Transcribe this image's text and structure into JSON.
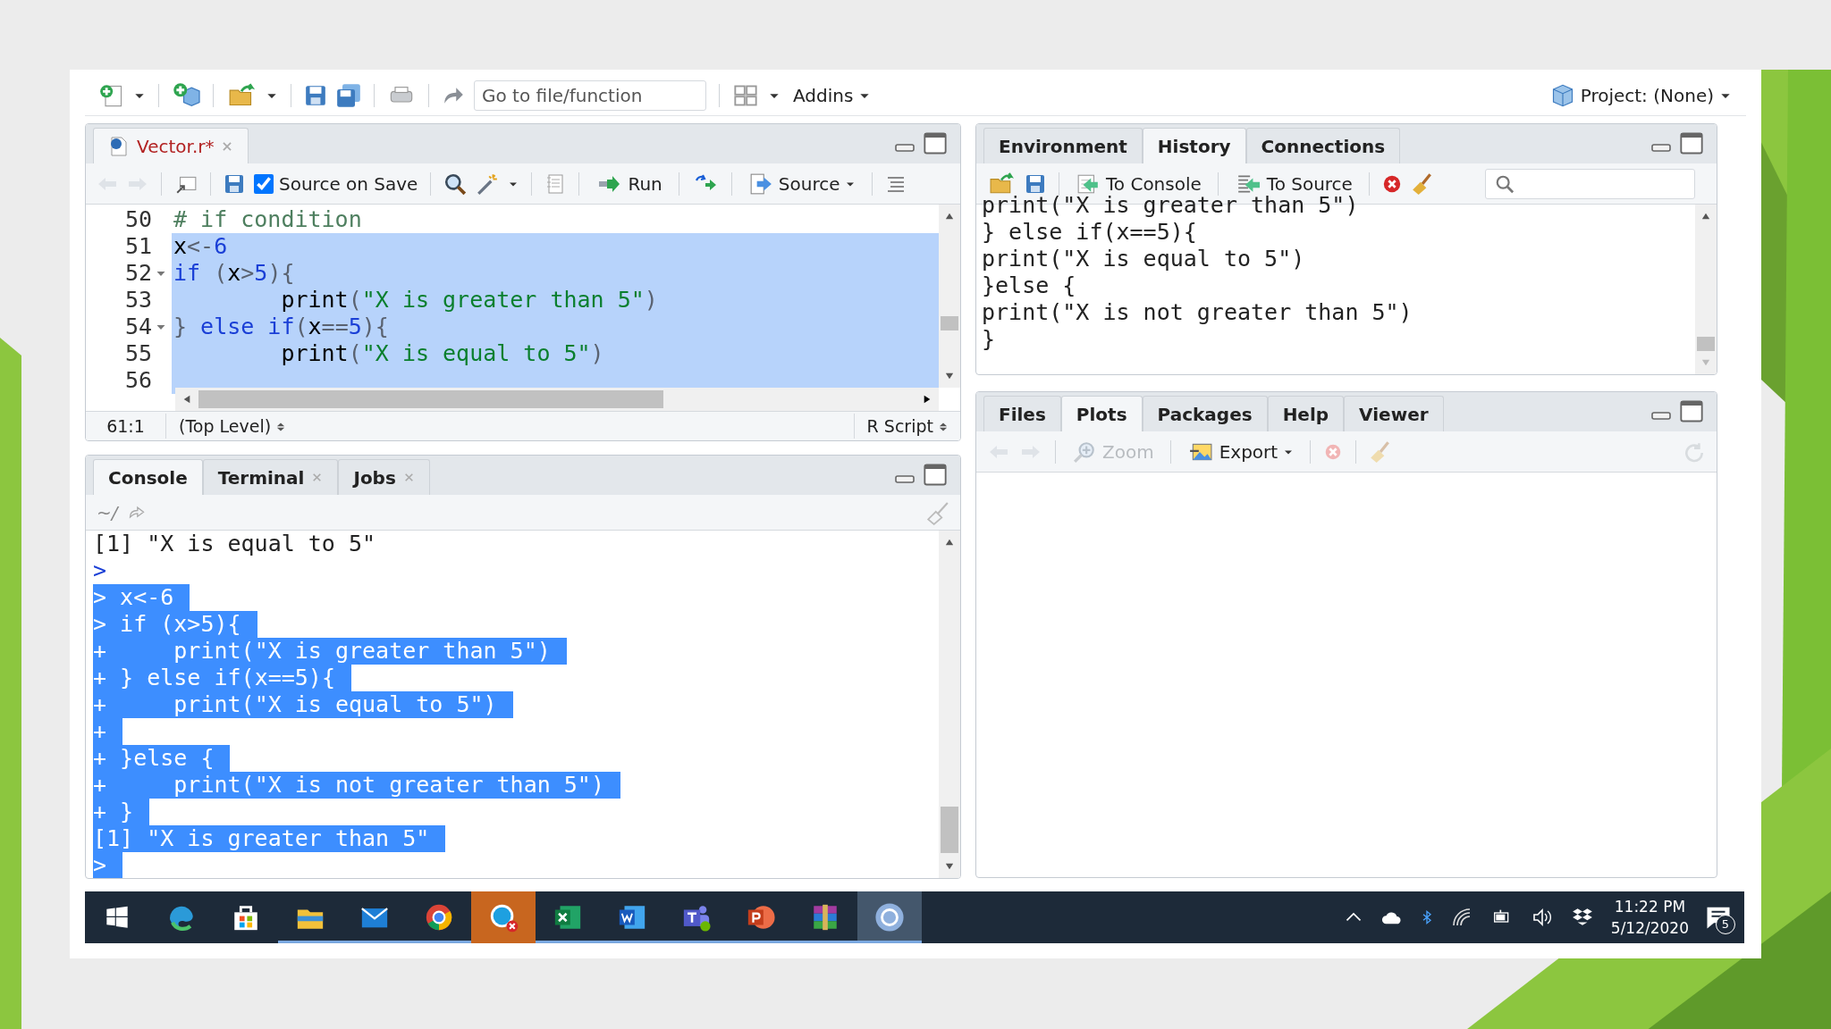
{
  "toolbar": {
    "goto_placeholder": "Go to file/function",
    "addins": "Addins",
    "project": "Project: (None)"
  },
  "editor": {
    "tab": {
      "title": "Vector.r*",
      "unsaved": true
    },
    "source_on_save": {
      "label": "Source on Save",
      "checked": true
    },
    "run": "Run",
    "source": "Source",
    "lines": [
      {
        "number": "50",
        "selected": false,
        "fold": false,
        "segments": [
          {
            "kind": "comment",
            "text": "# if condition"
          }
        ]
      },
      {
        "number": "51",
        "selected": true,
        "fold": false,
        "segments": [
          {
            "kind": "plain",
            "text": "x"
          },
          {
            "kind": "punct",
            "text": "<-"
          },
          {
            "kind": "number",
            "text": "6"
          }
        ]
      },
      {
        "number": "52",
        "selected": true,
        "fold": true,
        "segments": [
          {
            "kind": "keyword",
            "text": "if"
          },
          {
            "kind": "punct",
            "text": " ("
          },
          {
            "kind": "plain",
            "text": "x"
          },
          {
            "kind": "punct",
            "text": ">"
          },
          {
            "kind": "number",
            "text": "5"
          },
          {
            "kind": "punct",
            "text": "){"
          }
        ]
      },
      {
        "number": "53",
        "selected": true,
        "fold": false,
        "segments": [
          {
            "kind": "plain",
            "text": "        print"
          },
          {
            "kind": "punct",
            "text": "("
          },
          {
            "kind": "string",
            "text": "\"X is greater than 5\""
          },
          {
            "kind": "punct",
            "text": ")"
          }
        ]
      },
      {
        "number": "54",
        "selected": true,
        "fold": true,
        "segments": [
          {
            "kind": "punct",
            "text": "}"
          },
          {
            "kind": "keyword",
            "text": " else if"
          },
          {
            "kind": "punct",
            "text": "("
          },
          {
            "kind": "plain",
            "text": "x"
          },
          {
            "kind": "punct",
            "text": "=="
          },
          {
            "kind": "number",
            "text": "5"
          },
          {
            "kind": "punct",
            "text": "){"
          }
        ]
      },
      {
        "number": "55",
        "selected": true,
        "fold": false,
        "segments": [
          {
            "kind": "plain",
            "text": "        print"
          },
          {
            "kind": "punct",
            "text": "("
          },
          {
            "kind": "string",
            "text": "\"X is equal to 5\""
          },
          {
            "kind": "punct",
            "text": ")"
          }
        ]
      },
      {
        "number": "56",
        "selected": true,
        "fold": false
      }
    ],
    "status": {
      "position": "61:1",
      "scope": "(Top Level)",
      "file_type": "R Script"
    }
  },
  "console": {
    "tabs": [
      {
        "label": "Console",
        "selected": true,
        "closable": false
      },
      {
        "label": "Terminal",
        "selected": false,
        "closable": true
      },
      {
        "label": "Jobs",
        "selected": false,
        "closable": true
      }
    ],
    "path": "~/",
    "lines": [
      {
        "kind": "output",
        "text": "[1] \"X is equal to 5\"",
        "selected": false
      },
      {
        "kind": "input",
        "prompt": ">",
        "selected": false
      },
      {
        "kind": "input",
        "prompt": ">",
        "text": "x<-6",
        "selected": true
      },
      {
        "kind": "input",
        "prompt": ">",
        "text": "if (x>5){",
        "selected": true
      },
      {
        "kind": "input",
        "prompt": "+",
        "text": "    print(\"X is greater than 5\")",
        "selected": true
      },
      {
        "kind": "input",
        "prompt": "+",
        "text": "} else if(x==5){",
        "selected": true
      },
      {
        "kind": "input",
        "prompt": "+",
        "text": "    print(\"X is equal to 5\")",
        "selected": true
      },
      {
        "kind": "input",
        "prompt": "+",
        "selected": true
      },
      {
        "kind": "input",
        "prompt": "+",
        "text": "}else {",
        "selected": true
      },
      {
        "kind": "input",
        "prompt": "+",
        "text": "    print(\"X is not greater than 5\")",
        "selected": true
      },
      {
        "kind": "input",
        "prompt": "+",
        "text": "}",
        "selected": true
      },
      {
        "kind": "output",
        "text": "[1] \"X is greater than 5\"",
        "selected": true
      },
      {
        "kind": "input",
        "prompt": ">",
        "selected": true
      }
    ]
  },
  "history": {
    "tabs": [
      {
        "label": "Environment",
        "selected": false
      },
      {
        "label": "History",
        "selected": true
      },
      {
        "label": "Connections",
        "selected": false
      }
    ],
    "to_console": "To Console",
    "to_source": "To Source",
    "lines": [
      "print(\"X is greater than 5\")",
      "} else if(x==5){",
      "print(\"X is equal to 5\")",
      "}else {",
      "print(\"X is not greater than 5\")",
      "}"
    ]
  },
  "plots": {
    "tabs": [
      {
        "label": "Files",
        "selected": false
      },
      {
        "label": "Plots",
        "selected": true
      },
      {
        "label": "Packages",
        "selected": false
      },
      {
        "label": "Help",
        "selected": false
      },
      {
        "label": "Viewer",
        "selected": false
      }
    ],
    "zoom": {
      "label": "Zoom",
      "disabled": true
    },
    "export": {
      "label": "Export",
      "disabled": false
    }
  },
  "taskbar": {
    "apps": [
      {
        "kind": "edge",
        "running": false,
        "attention": false,
        "active": false
      },
      {
        "kind": "store",
        "running": false,
        "attention": false,
        "active": false
      },
      {
        "kind": "explorer",
        "running": true,
        "attention": false,
        "active": false
      },
      {
        "kind": "mail",
        "running": true,
        "attention": false,
        "active": false
      },
      {
        "kind": "chrome",
        "running": true,
        "attention": false,
        "active": false
      },
      {
        "kind": "skype",
        "running": false,
        "attention": true,
        "active": false
      },
      {
        "kind": "excel",
        "running": true,
        "attention": false,
        "active": false
      },
      {
        "kind": "word",
        "running": true,
        "attention": false,
        "active": false
      },
      {
        "kind": "teams",
        "running": true,
        "attention": false,
        "active": false
      },
      {
        "kind": "powerpoint",
        "running": true,
        "attention": false,
        "active": false
      },
      {
        "kind": "archive",
        "running": true,
        "attention": false,
        "active": false
      },
      {
        "kind": "r",
        "running": true,
        "attention": false,
        "active": true
      }
    ],
    "time": "11:22 PM",
    "date": "5/12/2020",
    "notifications": "5"
  }
}
